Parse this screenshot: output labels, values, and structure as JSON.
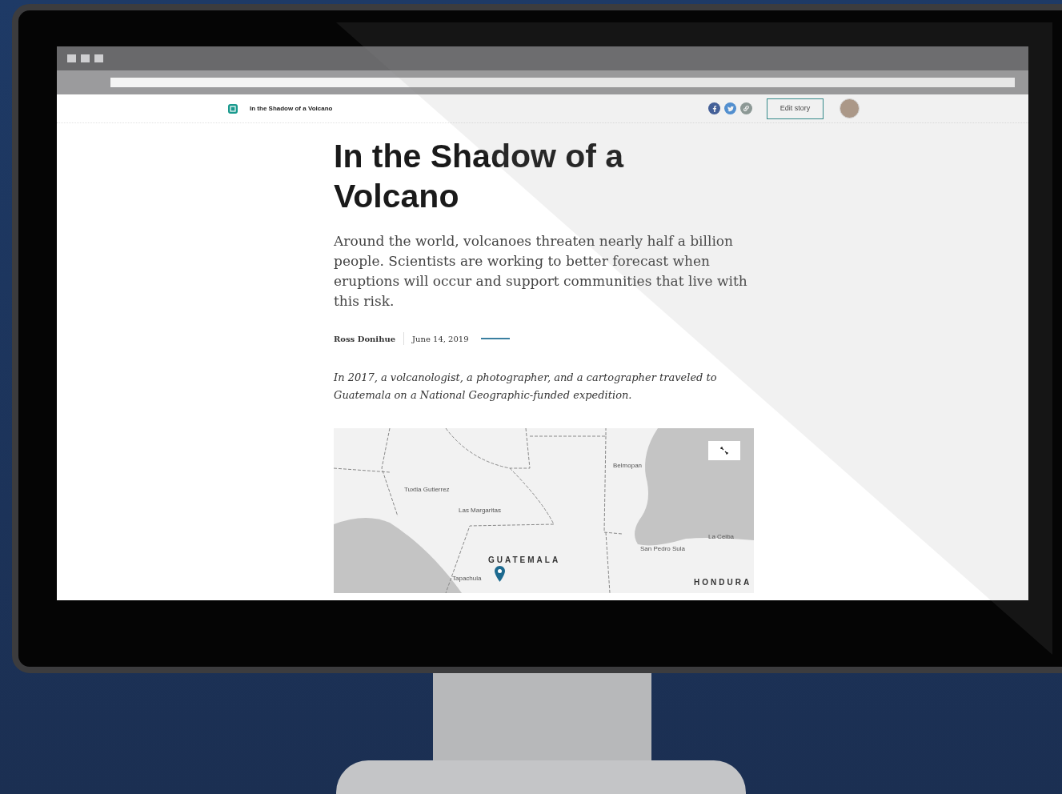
{
  "header": {
    "title": "In the Shadow of a Volcano",
    "button": "Edit story"
  },
  "article": {
    "title": "In the Shadow of a Volcano",
    "intro": "Around the world, volcanoes threaten nearly half a billion people. Scientists are working to better forecast when eruptions will occur and support communities that live with this risk.",
    "author": "Ross Donihue",
    "date": "June 14, 2019",
    "lede": "In 2017, a volcanologist, a photographer, and a cartographer traveled to Guatemala on a National Geographic-funded expedition."
  },
  "map": {
    "labels": [
      {
        "text": "Tuxtla Gutierrez",
        "kind": "city"
      },
      {
        "text": "Las Margaritas",
        "kind": "city"
      },
      {
        "text": "Belmopan",
        "kind": "city"
      },
      {
        "text": "La Ceiba",
        "kind": "city"
      },
      {
        "text": "San Pedro Sula",
        "kind": "city"
      },
      {
        "text": "GUATEMALA",
        "kind": "country"
      },
      {
        "text": "Tapachula",
        "kind": "city"
      },
      {
        "text": "HONDURA",
        "kind": "country"
      }
    ]
  }
}
